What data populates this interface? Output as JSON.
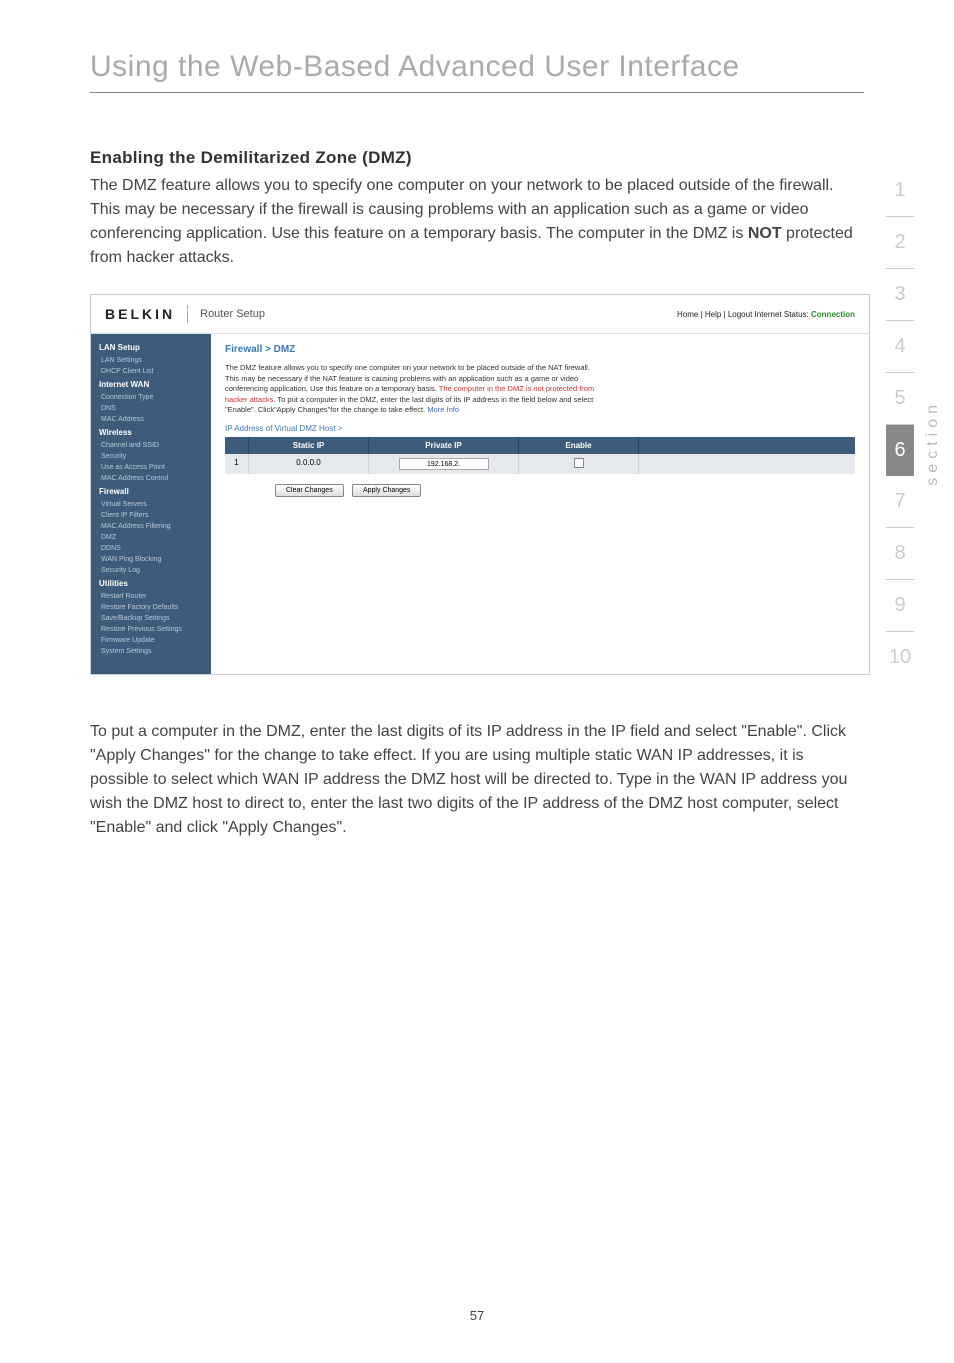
{
  "page": {
    "title": "Using the Web-Based Advanced User Interface",
    "number": "57"
  },
  "section": {
    "heading": "Enabling the Demilitarized Zone (DMZ)",
    "intro_before_bold": "The DMZ feature allows you to specify one computer on your network to be placed outside of the firewall. This may be necessary if the firewall is causing problems with an application such as a game or video conferencing application. Use this feature on a temporary basis. The computer in the DMZ is ",
    "intro_bold": "NOT",
    "intro_after_bold": " protected from hacker attacks.",
    "closing": "To put a computer in the DMZ, enter the last digits of its IP address in the IP field and select \"Enable\". Click \"Apply Changes\" for the change to take effect. If you are using multiple static WAN IP addresses, it is possible to select which WAN IP address the DMZ host will be directed to. Type in the WAN IP address you wish the DMZ host to direct to, enter the last two digits of the IP address of the DMZ host computer, select \"Enable\" and click \"Apply Changes\"."
  },
  "sideNav": {
    "items": [
      "1",
      "2",
      "3",
      "4",
      "5",
      "6",
      "7",
      "8",
      "9",
      "10"
    ],
    "active": "6",
    "label": "section"
  },
  "screenshot": {
    "logo": "BELKIN",
    "subtitle": "Router Setup",
    "topRight": "Home | Help | Logout   Internet Status: ",
    "topRightStatus": "Connection",
    "nav": {
      "s1": "LAN Setup",
      "s1a": "LAN Settings",
      "s1b": "DHCP Client List",
      "s2": "Internet WAN",
      "s2a": "Connection Type",
      "s2b": "DNS",
      "s2c": "MAC Address",
      "s3": "Wireless",
      "s3a": "Channel and SSID",
      "s3b": "Security",
      "s3c": "Use as Access Point",
      "s3d": "MAC Address Control",
      "s4": "Firewall",
      "s4a": "Virtual Servers",
      "s4b": "Client IP Filters",
      "s4c": "MAC Address Filtering",
      "s4d": "DMZ",
      "s4e": "DDNS",
      "s4f": "WAN Ping Blocking",
      "s4g": "Security Log",
      "s5": "Utilities",
      "s5a": "Restart Router",
      "s5b": "Restore Factory Defaults",
      "s5c": "Save/Backup Settings",
      "s5d": "Restore Previous Settings",
      "s5e": "Firmware Update",
      "s5f": "System Settings"
    },
    "breadcrumb": "Firewall > DMZ",
    "desc1": "The DMZ feature allows you to specify one computer on your network to be placed outside of the NAT firewall. This may be necessary if the NAT feature is causing problems with an application such as a game or video conferencing application. Use this feature on a temporary basis.",
    "descRed": "The computer in the DMZ is not protected from hacker attacks.",
    "desc2": "To put a computer in the DMZ, enter the last digits of its IP address in the field below and select \"Enable\". Click\"Apply Changes\"for the change to take effect.",
    "descMore": "More Info",
    "subheading": "IP Address of Virtual DMZ Host >",
    "table": {
      "headers": {
        "static": "Static IP",
        "private": "Private IP",
        "enable": "Enable"
      },
      "row": {
        "num": "1",
        "static": "0.0.0.0",
        "private": "192.168.2."
      }
    },
    "buttons": {
      "clear": "Clear Changes",
      "apply": "Apply Changes"
    }
  }
}
